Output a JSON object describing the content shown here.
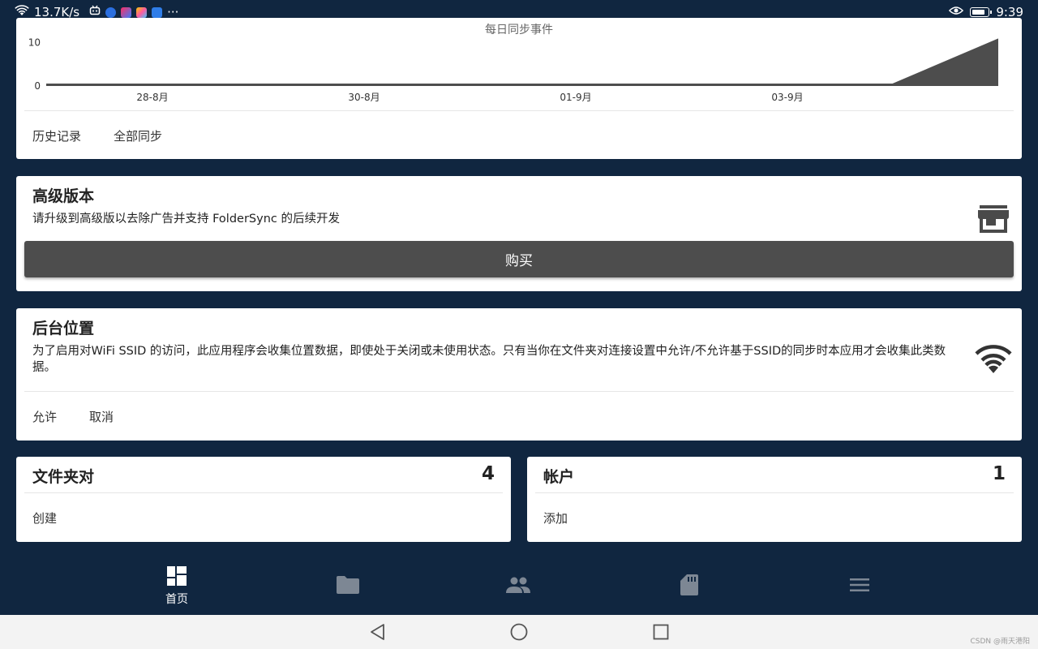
{
  "status_bar": {
    "speed": "13.7K/s",
    "more": "···",
    "time": "9:39",
    "battery_level": 0.8
  },
  "chart_data": {
    "type": "area",
    "title": "每日同步事件",
    "x": [
      "28-8月",
      "30-8月",
      "01-9月",
      "03-9月"
    ],
    "yticks": [
      0,
      10
    ],
    "ylim": [
      0,
      12
    ],
    "series": [
      {
        "values": [
          0,
          0,
          0,
          0,
          0,
          0,
          0,
          0,
          0,
          11
        ]
      }
    ],
    "grid": false
  },
  "history_card": {
    "history_label": "历史记录",
    "sync_all_label": "全部同步"
  },
  "premium_card": {
    "title": "高级版本",
    "description": "请升级到高级版以去除广告并支持 FolderSync 的后续开发",
    "buy_label": "购买",
    "icon": "store-icon"
  },
  "location_card": {
    "title": "后台位置",
    "description": "为了启用对WiFi SSID 的访问，此应用程序会收集位置数据，即使处于关闭或未使用状态。只有当你在文件夹对连接设置中允许/不允许基于SSID的同步时本应用才会收集此类数据。",
    "allow_label": "允许",
    "cancel_label": "取消",
    "icon": "wifi-icon"
  },
  "folderpairs_card": {
    "title": "文件夹对",
    "count": "4",
    "create_label": "创建"
  },
  "accounts_card": {
    "title": "帐户",
    "count": "1",
    "add_label": "添加"
  },
  "bottom_nav": {
    "home_label": "首页"
  },
  "watermark": "CSDN @雨天港阳"
}
